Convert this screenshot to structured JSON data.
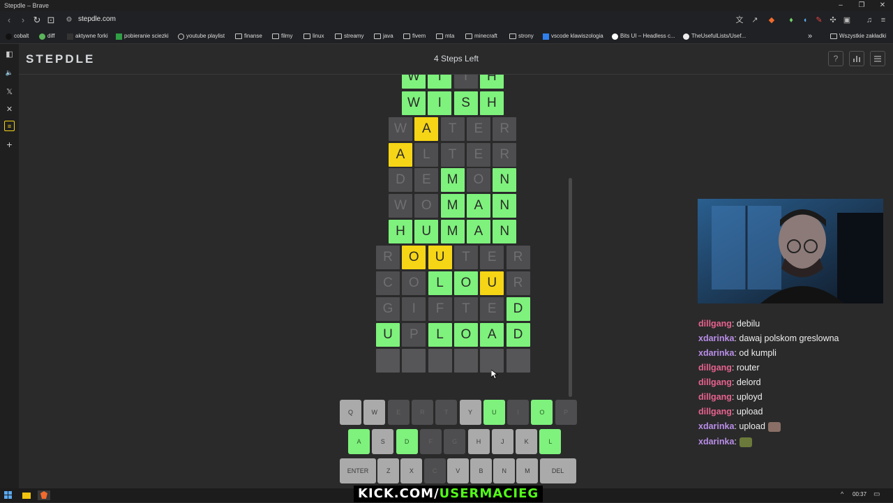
{
  "window": {
    "title": "Stepdle – Brave"
  },
  "browser": {
    "url": "stepdle.com"
  },
  "bookmarks": {
    "items": [
      "cobalt",
      "diff",
      "aktywne forki",
      "pobieranie sciezki",
      "youtube playlist",
      "finanse",
      "filmy",
      "linux",
      "streamy",
      "java",
      "fivem",
      "mta",
      "minecraft",
      "strony",
      "vscode klawiszologia",
      "Bits UI – Headless c...",
      "TheUsefulLists/Usef..."
    ],
    "all_label": "Wszystkie zakładki"
  },
  "app": {
    "logo": "STEPDLE",
    "steps_left": "4 Steps Left",
    "help_icon": "?",
    "stats_icon": "bar-chart-icon",
    "menu_icon": "menu-icon"
  },
  "board": {
    "rows": [
      {
        "word": "WITH",
        "states": [
          "g",
          "g",
          "d",
          "g"
        ]
      },
      {
        "word": "WISH",
        "states": [
          "g",
          "g",
          "g",
          "g"
        ]
      },
      {
        "word": "WATER",
        "states": [
          "d",
          "y",
          "d",
          "d",
          "d"
        ]
      },
      {
        "word": "ALTER",
        "states": [
          "y",
          "d",
          "d",
          "d",
          "d"
        ]
      },
      {
        "word": "DEMON",
        "states": [
          "d",
          "d",
          "g",
          "d",
          "g"
        ]
      },
      {
        "word": "WOMAN",
        "states": [
          "d",
          "d",
          "g",
          "g",
          "g"
        ]
      },
      {
        "word": "HUMAN",
        "states": [
          "g",
          "g",
          "g",
          "g",
          "g"
        ]
      },
      {
        "word": "ROUTER",
        "states": [
          "d",
          "y",
          "y",
          "d",
          "d",
          "d"
        ]
      },
      {
        "word": "COLOUR",
        "states": [
          "d",
          "d",
          "g",
          "g",
          "y",
          "d"
        ]
      },
      {
        "word": "GIFTED",
        "states": [
          "d",
          "d",
          "d",
          "d",
          "d",
          "g"
        ]
      },
      {
        "word": "UPLOAD",
        "states": [
          "g",
          "d",
          "g",
          "g",
          "g",
          "g"
        ]
      },
      {
        "word": "      ",
        "states": [
          "e",
          "e",
          "e",
          "e",
          "e",
          "e"
        ]
      }
    ]
  },
  "keyboard": {
    "row1": [
      {
        "k": "Q",
        "s": "n"
      },
      {
        "k": "W",
        "s": "n"
      },
      {
        "k": "E",
        "s": "d"
      },
      {
        "k": "R",
        "s": "d"
      },
      {
        "k": "T",
        "s": "d"
      },
      {
        "k": "Y",
        "s": "n"
      },
      {
        "k": "U",
        "s": "g"
      },
      {
        "k": "I",
        "s": "d"
      },
      {
        "k": "O",
        "s": "g"
      },
      {
        "k": "P",
        "s": "d"
      }
    ],
    "row2": [
      {
        "k": "A",
        "s": "g"
      },
      {
        "k": "S",
        "s": "n"
      },
      {
        "k": "D",
        "s": "g"
      },
      {
        "k": "F",
        "s": "d"
      },
      {
        "k": "G",
        "s": "d"
      },
      {
        "k": "H",
        "s": "n"
      },
      {
        "k": "J",
        "s": "n"
      },
      {
        "k": "K",
        "s": "n"
      },
      {
        "k": "L",
        "s": "g"
      }
    ],
    "row3": [
      {
        "k": "ENTER",
        "s": "n"
      },
      {
        "k": "Z",
        "s": "n"
      },
      {
        "k": "X",
        "s": "n"
      },
      {
        "k": "C",
        "s": "d"
      },
      {
        "k": "V",
        "s": "n"
      },
      {
        "k": "B",
        "s": "n"
      },
      {
        "k": "N",
        "s": "n"
      },
      {
        "k": "M",
        "s": "n"
      },
      {
        "k": "DEL",
        "s": "n"
      }
    ]
  },
  "chat": [
    {
      "user": "dillgang",
      "color": "#e8628e",
      "msg": ": debilu"
    },
    {
      "user": "xdarinka",
      "color": "#b98ee8",
      "msg": ": dawaj polskom greslowna"
    },
    {
      "user": "xdarinka",
      "color": "#b98ee8",
      "msg": ": od kumpli"
    },
    {
      "user": "dillgang",
      "color": "#e8628e",
      "msg": ": router"
    },
    {
      "user": "dillgang",
      "color": "#e8628e",
      "msg": ": delord"
    },
    {
      "user": "dillgang",
      "color": "#e8628e",
      "msg": ": uployd"
    },
    {
      "user": "dillgang",
      "color": "#e8628e",
      "msg": ": upload"
    },
    {
      "user": "xdarinka",
      "color": "#b98ee8",
      "msg": ": upload"
    },
    {
      "user": "xdarinka",
      "color": "#b98ee8",
      "msg": ":"
    }
  ],
  "overlay": {
    "kick_prefix": "KICK.COM/",
    "kick_user": "USERMACIEG"
  },
  "taskbar": {
    "time": "00:37"
  }
}
